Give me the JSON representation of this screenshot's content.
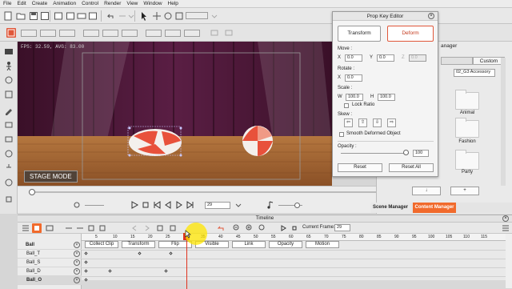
{
  "menu": [
    "File",
    "Edit",
    "Create",
    "Animation",
    "Control",
    "Render",
    "View",
    "Window",
    "Help"
  ],
  "viewport": {
    "fps_text": "FPS: 32.59, AVG: 83.00",
    "stage_mode": "STAGE MODE"
  },
  "playback": {
    "frame_value": "29"
  },
  "prop_key_editor": {
    "title": "Prop Key Editor",
    "transform_label": "Transform",
    "deform_label": "Deform",
    "move_label": "Move :",
    "rotate_label": "Rotate :",
    "scale_label": "Scale :",
    "skew_label": "Skew :",
    "opacity_label": "Opacity :",
    "x_label": "X",
    "y_label": "Y",
    "z_label": "Z",
    "w_label": "W",
    "h_label": "H",
    "move_x": "0.0",
    "move_y": "0.0",
    "move_z": "0.0",
    "rotate_x": "0.0",
    "scale_w": "100.0",
    "scale_h": "100.0",
    "lock_ratio": "Lock Ratio",
    "smooth_deformed": "Smooth Deformed Object",
    "opacity_value": "100",
    "reset": "Reset",
    "reset_all": "Reset All"
  },
  "content_panel": {
    "title_partial": "anager",
    "custom_tab": "Custom",
    "dropdown_value": "02_G3 Accessory",
    "folders": [
      "Animal",
      "Fashion",
      "Party"
    ]
  },
  "bottom_tabs": {
    "scene_manager": "Scene Manager",
    "content_manager": "Content Manager"
  },
  "timeline": {
    "title": "Timeline",
    "current_frame_label": "Current Frame:",
    "current_frame_value": "29",
    "ruler": [
      "5",
      "10",
      "15",
      "20",
      "25",
      "30",
      "35",
      "40",
      "45",
      "50",
      "55",
      "60",
      "65",
      "70",
      "75",
      "80",
      "85",
      "90",
      "95",
      "100",
      "105",
      "110",
      "115"
    ],
    "tracks": [
      "Ball",
      "Ball_T",
      "Ball_S",
      "Ball_D",
      "Ball_O"
    ],
    "clip_headers": [
      "Collect Clip",
      "Transform",
      "Flip",
      "Visible",
      "Link",
      "Opacity",
      "Motion"
    ]
  },
  "colors": {
    "accent": "#e0573a",
    "highlight": "#f16a2c"
  }
}
